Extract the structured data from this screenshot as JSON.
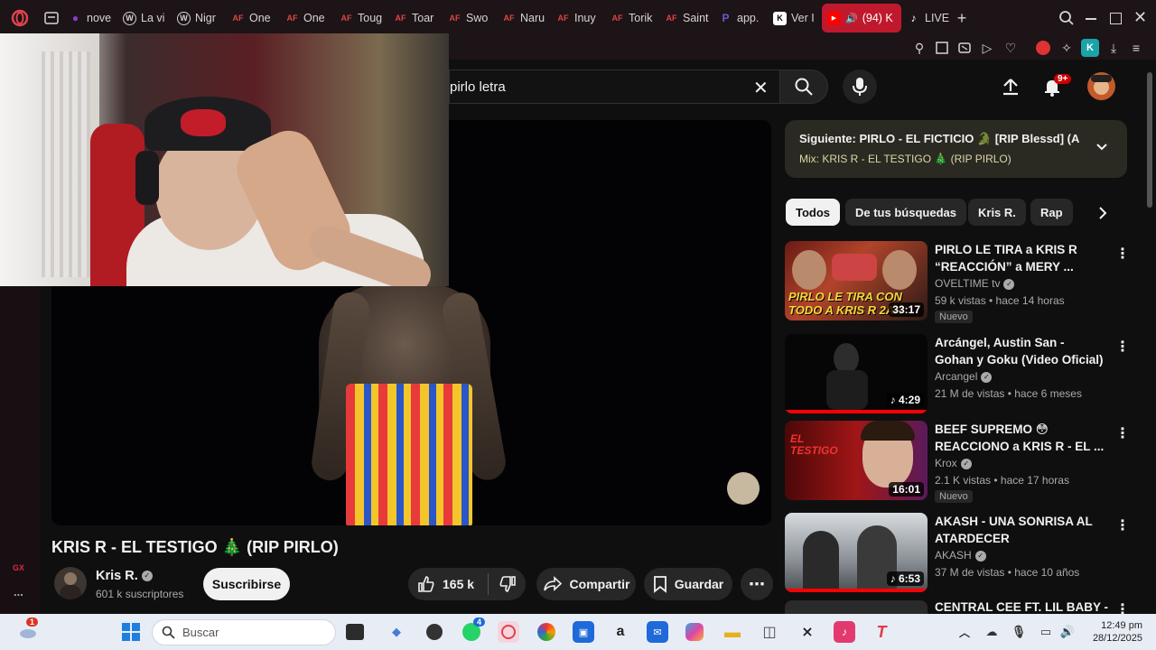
{
  "browser": {
    "tabs": [
      {
        "label": "nove",
        "icon": "multicolor-icon",
        "color": "#8a3ccc"
      },
      {
        "label": "La vi",
        "icon": "wordpress-icon",
        "color": "#d9d3d4"
      },
      {
        "label": "Nigr",
        "icon": "wordpress-icon",
        "color": "#d9d3d4"
      },
      {
        "label": "One",
        "icon": "af-icon",
        "color": "#d44"
      },
      {
        "label": "One",
        "icon": "af-icon",
        "color": "#d44"
      },
      {
        "label": "Toug",
        "icon": "af-icon",
        "color": "#d44"
      },
      {
        "label": "Toar",
        "icon": "af-icon",
        "color": "#d44"
      },
      {
        "label": "Swo",
        "icon": "af-icon",
        "color": "#d44"
      },
      {
        "label": "Naru",
        "icon": "af-icon",
        "color": "#d44"
      },
      {
        "label": "Inuy",
        "icon": "af-icon",
        "color": "#d44"
      },
      {
        "label": "Torik",
        "icon": "af-icon",
        "color": "#d44"
      },
      {
        "label": "Saint",
        "icon": "af-icon",
        "color": "#d44"
      },
      {
        "label": "app.",
        "icon": "app-icon",
        "color": "#6a5acd"
      },
      {
        "label": "Ver I",
        "icon": "k-icon",
        "color": "#fff"
      },
      {
        "label": "(94) K",
        "icon": "youtube-icon",
        "color": "#fff",
        "active": true
      },
      {
        "label": "LIVE",
        "icon": "tiktok-icon",
        "color": "#fff"
      }
    ],
    "new_tab": "+"
  },
  "youtube": {
    "search_query": "pirlo letra",
    "notifications_badge": "9+",
    "video_title": "KRIS R - EL TESTIGO 🎄 (RIP PIRLO)",
    "channel_name": "Kris R.",
    "subscribers": "601 k suscriptores",
    "subscribe_label": "Suscribirse",
    "likes": "165 k",
    "share_label": "Compartir",
    "save_label": "Guardar",
    "next_up": "Siguiente: PIRLO - EL FICTICIO 🐊 [RIP Blessd] (Au...",
    "mix_label": "Mix: KRIS R - EL TESTIGO 🎄 (RIP PIRLO)",
    "chips": [
      "Todos",
      "De tus búsquedas",
      "Kris R.",
      "Rap"
    ],
    "recommendations": [
      {
        "title": "PIRLO LE TIRA a KRIS R “REACCIÓN” a MERY ...",
        "channel": "OVELTIME tv",
        "meta": "59 k vistas • hace 14 horas",
        "duration": "33:17",
        "nuevo": "Nuevo",
        "thumb_text": "PIRLO LE TIRA CON TODO A KRIS R 2AH"
      },
      {
        "title": "Arcángel, Austin San - Gohan y Goku (Video Oficial)",
        "channel": "Arcangel",
        "meta": "21 M de vistas • hace 6 meses",
        "duration": "♪ 4:29",
        "nuevo": "",
        "thumb_text": "",
        "progress": 1.0
      },
      {
        "title": "BEEF SUPREMO 😳 REACCIONO a KRIS R - EL ...",
        "channel": "Krox",
        "meta": "2.1 K vistas • hace 17 horas",
        "duration": "16:01",
        "nuevo": "Nuevo",
        "thumb_text": "EL TESTIGO"
      },
      {
        "title": "AKASH - UNA SONRISA AL ATARDECER",
        "channel": "AKASH",
        "meta": "37 M de vistas • hace 10 años",
        "duration": "♪ 6:53",
        "nuevo": "",
        "thumb_text": "",
        "progress": 1.0
      },
      {
        "title": "CENTRAL CEE FT. LIL BABY - ",
        "channel": "",
        "meta": "",
        "duration": "",
        "nuevo": "",
        "thumb_text": ""
      }
    ]
  },
  "taskbar": {
    "search_placeholder": "Buscar",
    "time": "12:49 pm",
    "date": "28/12/2025",
    "notif_badge": "1",
    "whatsapp_badge": "4"
  },
  "sidebar": {
    "gx_label": "GX",
    "more_label": "..."
  },
  "colors": {
    "accent": "#c0192d",
    "youtube_red": "#ff0000",
    "background": "#0f0f0f"
  }
}
